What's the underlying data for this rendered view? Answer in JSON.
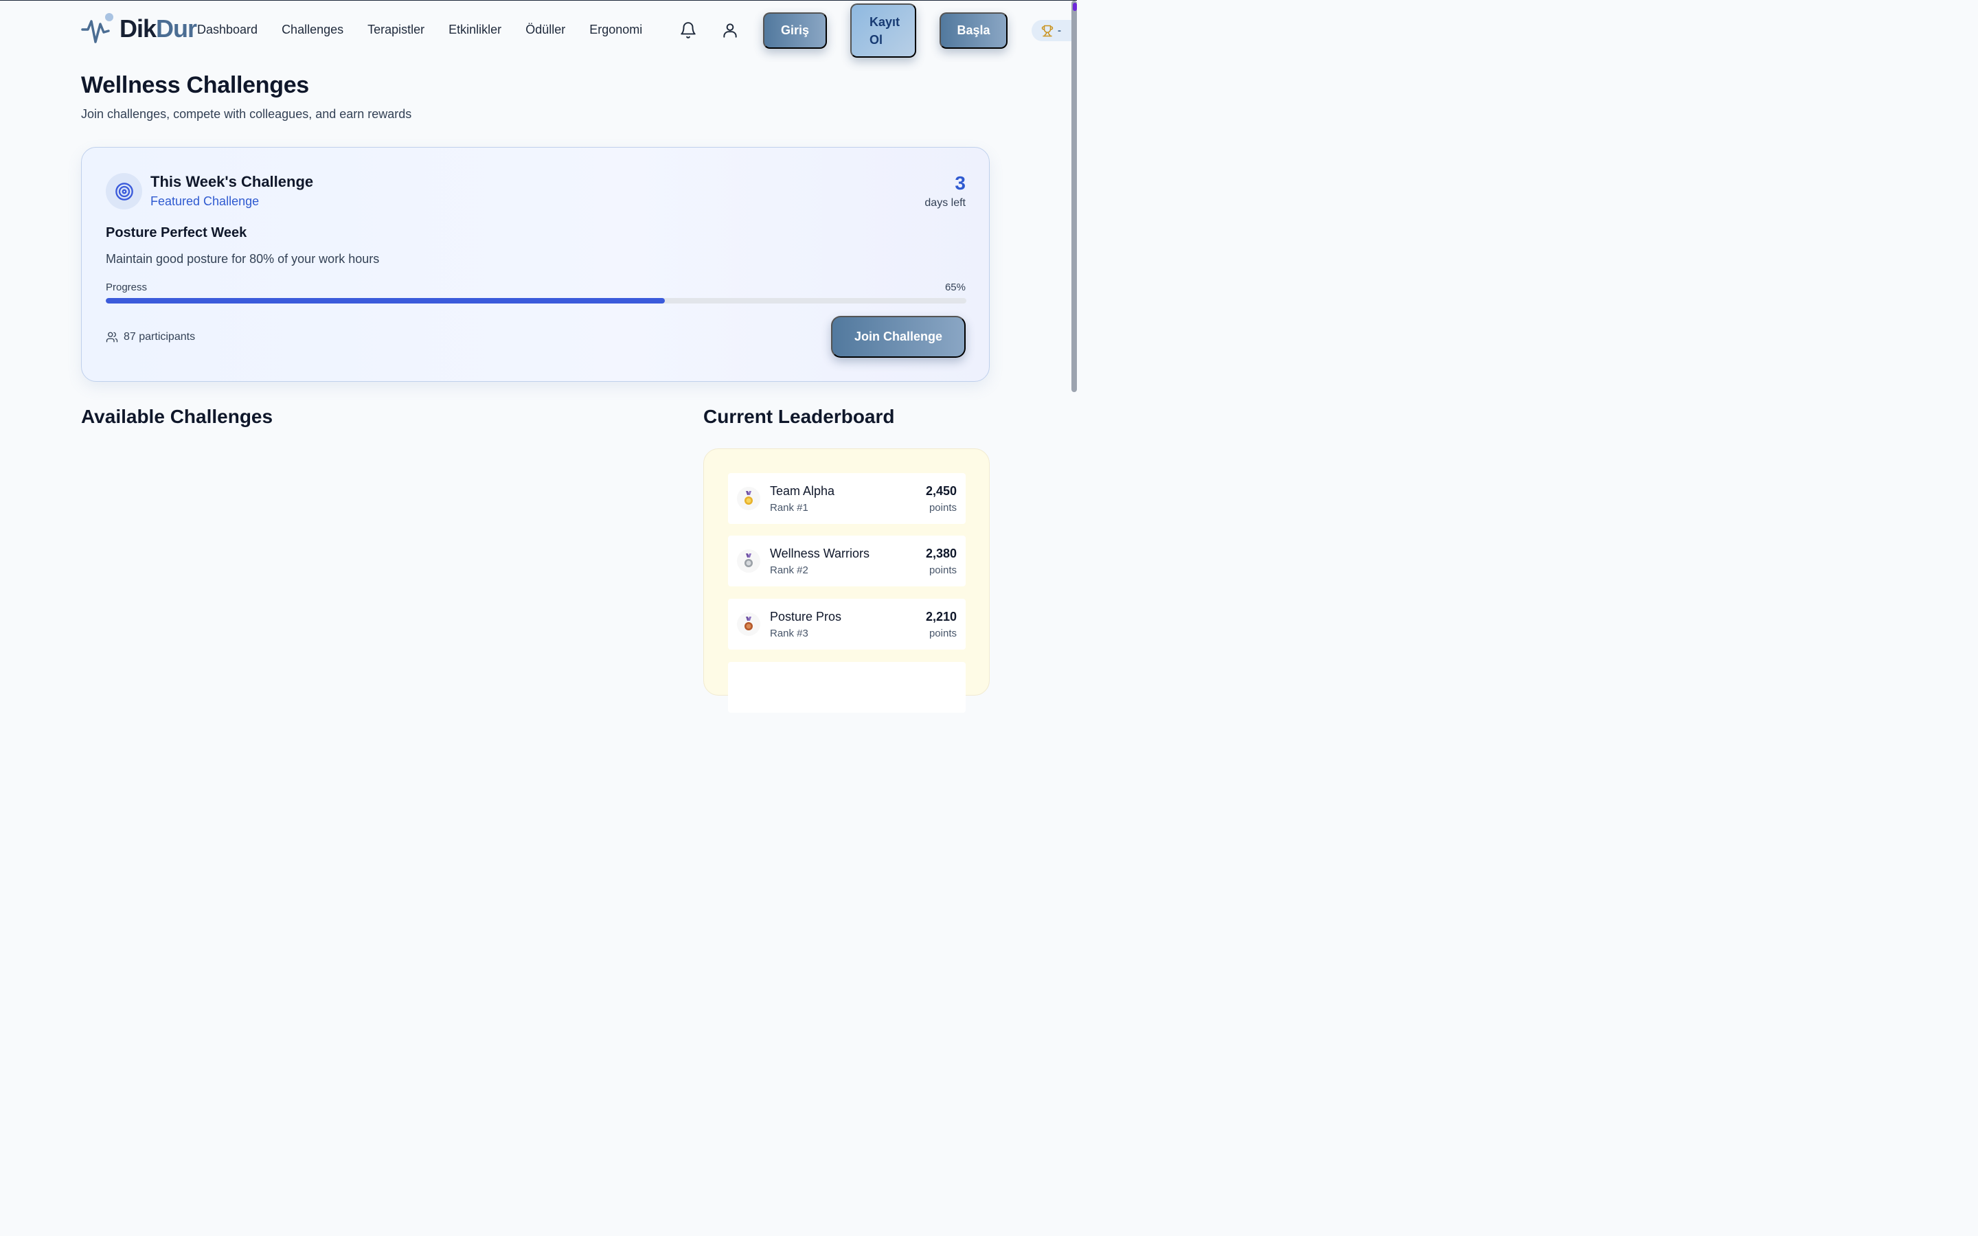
{
  "brand": {
    "part1": "Dik",
    "part2": "Dur"
  },
  "nav": {
    "links": [
      "Dashboard",
      "Challenges",
      "Terapistler",
      "Etkinlikler",
      "Ödüller",
      "Ergonomi"
    ],
    "login_label": "Giriş",
    "register_line1": "Kayıt",
    "register_line2": "Ol",
    "start_label": "Başla",
    "trophy_value": "-"
  },
  "header": {
    "title": "Wellness Challenges",
    "subtitle": "Join challenges, compete with colleagues, and earn rewards"
  },
  "featured": {
    "title": "This Week's Challenge",
    "tag": "Featured Challenge",
    "days_value": "3",
    "days_label": "days left",
    "challenge_name": "Posture Perfect Week",
    "challenge_desc": "Maintain good posture for 80% of your work hours",
    "progress_label": "Progress",
    "progress_pct_text": "65%",
    "progress_fraction": 0.65,
    "participants_text": "87 participants",
    "join_label": "Join Challenge"
  },
  "sections": {
    "available_title": "Available Challenges",
    "leaderboard_title": "Current Leaderboard"
  },
  "leaderboard": [
    {
      "name": "Team Alpha",
      "rank": "Rank #1",
      "points": "2,450",
      "points_label": "points",
      "medal": "gold-medal-icon"
    },
    {
      "name": "Wellness Warriors",
      "rank": "Rank #2",
      "points": "2,380",
      "points_label": "points",
      "medal": "silver-medal-icon"
    },
    {
      "name": "Posture Pros",
      "rank": "Rank #3",
      "points": "2,210",
      "points_label": "points",
      "medal": "bronze-medal-icon"
    }
  ],
  "colors": {
    "accent": "#3b5bdb",
    "button_gradient_start": "#52799e",
    "button_gradient_end": "#8aa6c4",
    "leaderboard_bg": "#fefbe6"
  }
}
